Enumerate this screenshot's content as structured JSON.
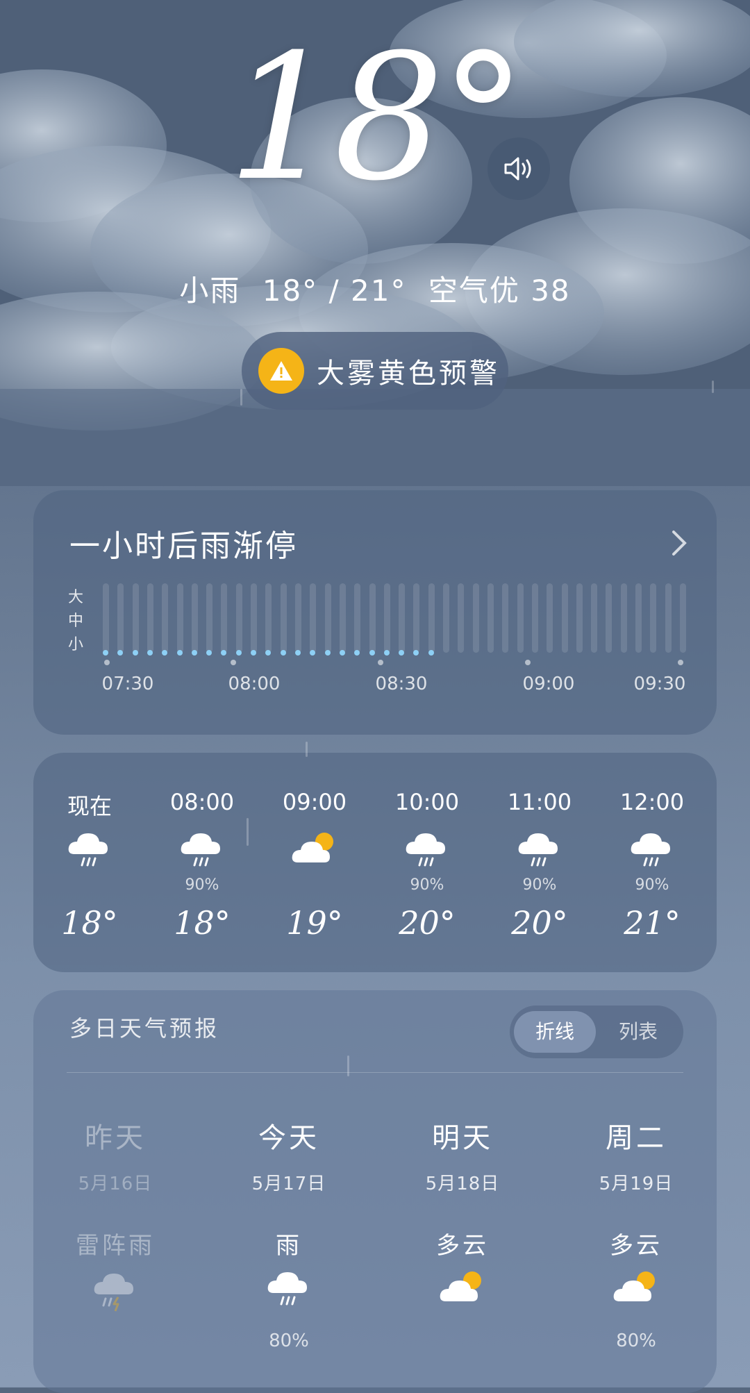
{
  "current": {
    "temperature": "18°",
    "summary_condition": "小雨",
    "summary_range": "18° / 21°",
    "summary_aqi": "空气优 38"
  },
  "alert": {
    "label": "大雾黄色预警"
  },
  "precip_card": {
    "title": "一小时后雨渐停",
    "scale": [
      "大",
      "中",
      "小"
    ],
    "times": [
      "07:30",
      "08:00",
      "08:30",
      "09:00",
      "09:30"
    ]
  },
  "hourly": [
    {
      "time": "现在",
      "icon": "rain-cloud-icon",
      "prob": "",
      "temp": "18°"
    },
    {
      "time": "08:00",
      "icon": "rain-cloud-icon",
      "prob": "90%",
      "temp": "18°"
    },
    {
      "time": "09:00",
      "icon": "partly-cloudy-icon",
      "prob": "",
      "temp": "19°"
    },
    {
      "time": "10:00",
      "icon": "rain-cloud-icon",
      "prob": "90%",
      "temp": "20°"
    },
    {
      "time": "11:00",
      "icon": "rain-cloud-icon",
      "prob": "90%",
      "temp": "20°"
    },
    {
      "time": "12:00",
      "icon": "rain-cloud-icon",
      "prob": "90%",
      "temp": "21°"
    }
  ],
  "multi_day": {
    "title": "多日天气预报",
    "toggle_on": "折线",
    "toggle_off": "列表",
    "days": [
      {
        "name": "昨天",
        "date": "5月16日",
        "condition": "雷阵雨",
        "icon": "thunder-rain-icon",
        "prob": ""
      },
      {
        "name": "今天",
        "date": "5月17日",
        "condition": "雨",
        "icon": "rain-cloud-icon",
        "prob": "80%"
      },
      {
        "name": "明天",
        "date": "5月18日",
        "condition": "多云",
        "icon": "partly-cloudy-icon",
        "prob": ""
      },
      {
        "name": "周二",
        "date": "5月19日",
        "condition": "多云",
        "icon": "partly-cloudy-icon",
        "prob": "80%"
      }
    ]
  },
  "colors": {
    "alert": "#f5b417",
    "precip_dot": "#8ed0f5",
    "sun": "#f5b417"
  }
}
